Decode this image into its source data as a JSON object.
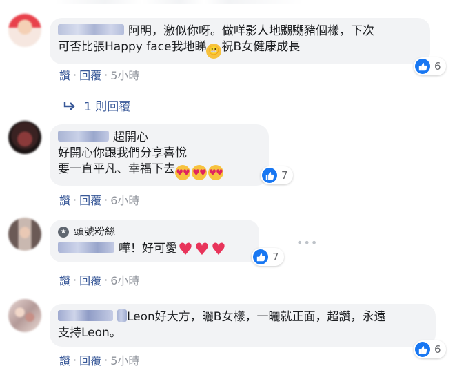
{
  "comments": [
    {
      "text_line1": "阿明，激似你呀。做咩影人地嬲嬲豬個樣，下次",
      "text_line2_a": "可否比張Happy face我地睇",
      "text_line2_b": "祝B女健康成長",
      "reactions": "6",
      "like": "讚",
      "reply": "回覆",
      "time": "5小時",
      "replies_link": "1 則回覆"
    },
    {
      "line1": "超開心",
      "line2": "好開心你跟我們分享喜悅",
      "line3": "要一直平凡、幸福下去",
      "reactions": "7",
      "like": "讚",
      "reply": "回覆",
      "time": "6小時"
    },
    {
      "badge": "頭號粉絲",
      "text": "嘩！好可愛",
      "reactions": "7",
      "like": "讚",
      "reply": "回覆",
      "time": "6小時"
    },
    {
      "line1_a": "Leon好大方，曬B女樣，一曬就正面，超讚，永遠",
      "line2": "支持Leon。",
      "reactions": "6",
      "like": "讚",
      "reply": "回覆",
      "time": "5小時"
    }
  ],
  "separator": "·",
  "more_label": "•••",
  "colors": {
    "link": "#385898",
    "bubble": "#f2f3f5",
    "like_blue": "#1877f2",
    "meta": "#90949c"
  }
}
